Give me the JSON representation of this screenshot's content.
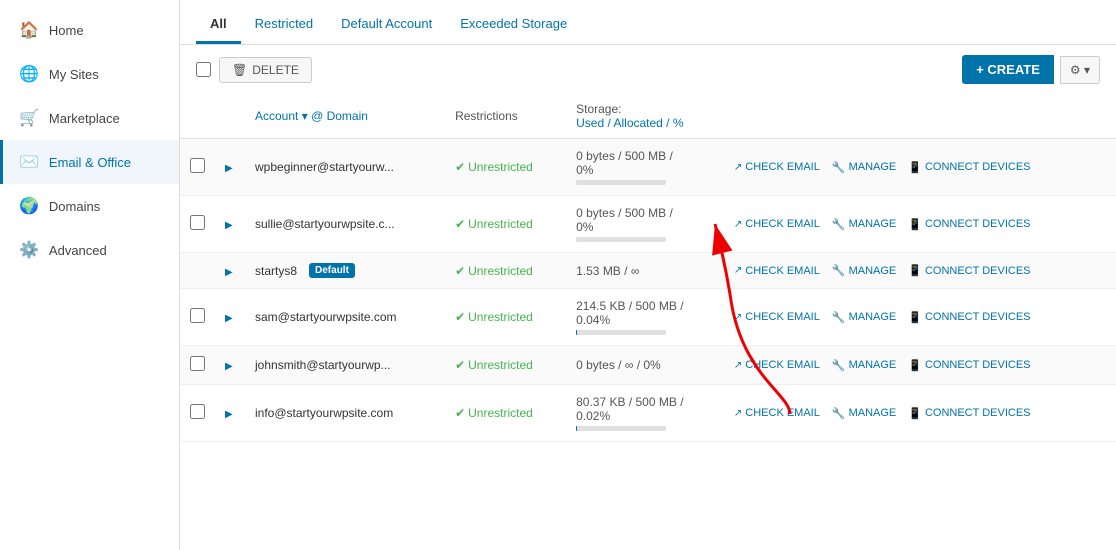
{
  "sidebar": {
    "items": [
      {
        "id": "home",
        "label": "Home",
        "icon": "🏠",
        "active": false
      },
      {
        "id": "my-sites",
        "label": "My Sites",
        "icon": "🌐",
        "active": false
      },
      {
        "id": "marketplace",
        "label": "Marketplace",
        "icon": "🛒",
        "active": false
      },
      {
        "id": "email-office",
        "label": "Email & Office",
        "icon": "✉️",
        "active": true
      },
      {
        "id": "domains",
        "label": "Domains",
        "icon": "🌍",
        "active": false
      },
      {
        "id": "advanced",
        "label": "Advanced",
        "icon": "⚙️",
        "active": false
      }
    ]
  },
  "tabs": [
    {
      "id": "all",
      "label": "All",
      "active": true
    },
    {
      "id": "restricted",
      "label": "Restricted",
      "active": false
    },
    {
      "id": "default-account",
      "label": "Default Account",
      "active": false
    },
    {
      "id": "exceeded-storage",
      "label": "Exceeded Storage",
      "active": false
    }
  ],
  "toolbar": {
    "delete_label": "DELETE",
    "create_label": "+ CREATE",
    "gear_icon": "▾"
  },
  "table": {
    "columns": {
      "account": "Account",
      "sort_icon": "▾",
      "domain": "@ Domain",
      "restrictions": "Restrictions",
      "storage_label": "Storage:",
      "storage_sub": "Used / Allocated / %"
    },
    "rows": [
      {
        "id": "row1",
        "account": "wpbeginner@startyourw...",
        "default": false,
        "restriction": "Unrestricted",
        "storage_used": "0 bytes / 500 MB /",
        "storage_pct": "0%",
        "bar_pct": 0,
        "actions": [
          "CHECK EMAIL",
          "MANAGE",
          "CONNECT DEVICES"
        ]
      },
      {
        "id": "row2",
        "account": "sullie@startyourwpsite.c...",
        "default": false,
        "restriction": "Unrestricted",
        "storage_used": "0 bytes / 500 MB /",
        "storage_pct": "0%",
        "bar_pct": 0,
        "actions": [
          "CHECK EMAIL",
          "MANAGE",
          "CONNECT DEVICES"
        ]
      },
      {
        "id": "row3",
        "account": "startys8",
        "default": true,
        "default_label": "Default",
        "restriction": "Unrestricted",
        "storage_used": "1.53 MB / ∞",
        "storage_pct": "",
        "bar_pct": -1,
        "actions": [
          "CHECK EMAIL",
          "MANAGE",
          "CONNECT DEVICES"
        ]
      },
      {
        "id": "row4",
        "account": "sam@startyourwpsite.com",
        "default": false,
        "restriction": "Unrestricted",
        "storage_used": "214.5 KB / 500 MB /",
        "storage_pct": "0.04%",
        "bar_pct": 0.04,
        "actions": [
          "CHECK EMAIL",
          "MANAGE",
          "CONNECT DEVICES"
        ]
      },
      {
        "id": "row5",
        "account": "johnsmith@startyourwp...",
        "default": false,
        "restriction": "Unrestricted",
        "storage_used": "0 bytes / ∞ / 0%",
        "storage_pct": "",
        "bar_pct": -1,
        "actions": [
          "CHECK EMAIL",
          "MANAGE",
          "CONNECT DEVICES"
        ]
      },
      {
        "id": "row6",
        "account": "info@startyourwpsite.com",
        "default": false,
        "restriction": "Unrestricted",
        "storage_used": "80.37 KB / 500 MB /",
        "storage_pct": "0.02%",
        "bar_pct": 0.02,
        "actions": [
          "CHECK EMAIL",
          "MANAGE",
          "CONNECT DEVICES"
        ]
      }
    ]
  },
  "colors": {
    "active_blue": "#0073aa",
    "green_check": "#46b450",
    "default_badge_bg": "#0073aa"
  }
}
